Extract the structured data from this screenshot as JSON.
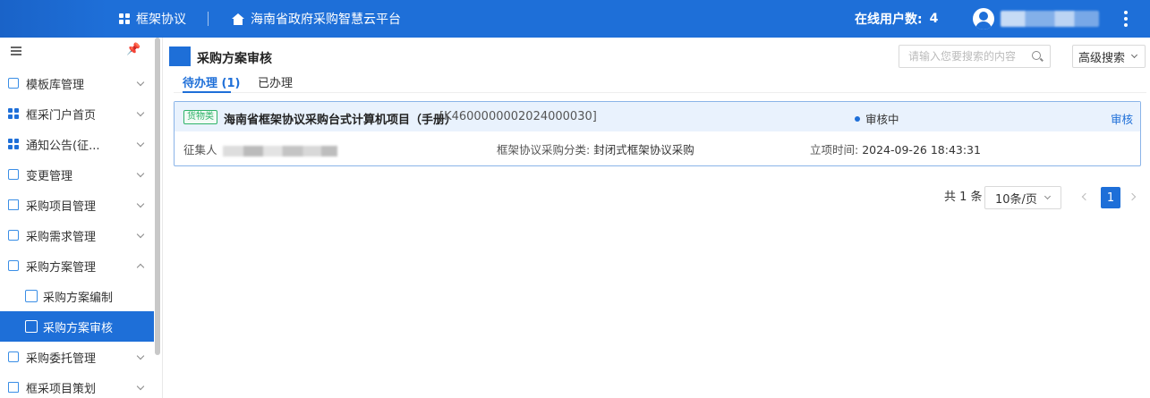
{
  "header": {
    "app_name": "框架协议",
    "platform_name": "海南省政府采购智慧云平台",
    "online_users_label": "在线用户数:",
    "online_users_count": "4"
  },
  "sidebar": {
    "items": [
      {
        "label": "模板库管理",
        "icon": "template-icon"
      },
      {
        "label": "框采门户首页",
        "icon": "grid-icon"
      },
      {
        "label": "通知公告(征...",
        "icon": "grid-icon"
      },
      {
        "label": "变更管理",
        "icon": "change-icon"
      },
      {
        "label": "采购项目管理",
        "icon": "folder-icon"
      },
      {
        "label": "采购需求管理",
        "icon": "document-icon"
      },
      {
        "label": "采购方案管理",
        "icon": "document-icon"
      },
      {
        "label": "采购方案编制",
        "icon": "edit-document-icon"
      },
      {
        "label": "采购方案审核",
        "icon": "review-document-icon"
      },
      {
        "label": "采购委托管理",
        "icon": "document-icon"
      },
      {
        "label": "框采项目策划",
        "icon": "folder-icon"
      }
    ]
  },
  "main": {
    "page_title": "采购方案审核",
    "search": {
      "placeholder": "请输入您要搜索的内容"
    },
    "advanced_search_label": "高级搜索",
    "tabs": [
      {
        "label": "待办理 (1)"
      },
      {
        "label": "已办理"
      }
    ],
    "card": {
      "tag": "货物类",
      "title": "海南省框架协议采购台式计算机项目（手册）",
      "code": "[K4600000002024000030]",
      "status": "审核中",
      "action": "审核",
      "collector_label": "征集人",
      "category_label": "框架协议采购分类:",
      "category_value": "封闭式框架协议采购",
      "time_label": "立项时间:",
      "time_value": "2024-09-26 18:43:31"
    },
    "pagination": {
      "total": "共 1 条",
      "page_size": "10条/页",
      "current_page": "1"
    }
  },
  "colors": {
    "primary": "#1e6fd8",
    "tag_green": "#2fb36a"
  }
}
